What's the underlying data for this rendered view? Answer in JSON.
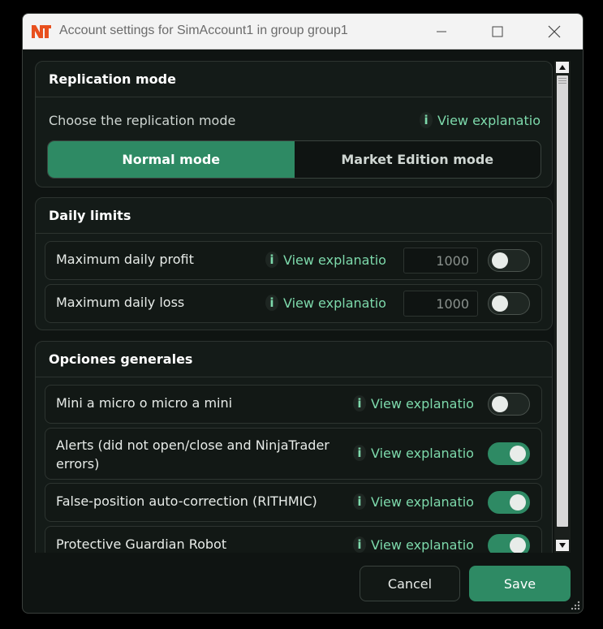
{
  "window": {
    "title": "Account settings for SimAccount1 in group group1",
    "logo_text": "NT"
  },
  "replication": {
    "header": "Replication mode",
    "label": "Choose the replication mode",
    "explain": "View explanatio",
    "modes": [
      "Normal mode",
      "Market Edition mode"
    ],
    "selected": "Normal mode"
  },
  "daily_limits": {
    "header": "Daily limits",
    "rows": [
      {
        "label": "Maximum daily profit",
        "explain": "View explanatio",
        "value": "1000",
        "enabled": false
      },
      {
        "label": "Maximum daily loss",
        "explain": "View explanatio",
        "value": "1000",
        "enabled": false
      }
    ]
  },
  "general": {
    "header": "Opciones generales",
    "rows": [
      {
        "label": "Mini a micro o micro a mini",
        "explain": "View explanatio",
        "enabled": false
      },
      {
        "label_line1": "Alerts (did not open/close and NinjaTrader",
        "label_line2": "errors)",
        "explain": "View explanatio",
        "enabled": true
      },
      {
        "label": "False-position auto-correction (RITHMIC)",
        "explain": "View explanatio",
        "enabled": true
      },
      {
        "label": "Protective Guardian Robot",
        "explain": "View explanatio",
        "enabled": true
      }
    ]
  },
  "footer": {
    "cancel_label": "Cancel",
    "save_label": "Save"
  },
  "icons": {
    "info": "i",
    "logo": "nt-logo-icon",
    "minimize": "minimize-icon",
    "maximize": "maximize-icon",
    "close": "close-icon"
  },
  "colors": {
    "accent": "#2e8a64",
    "link": "#7dd9ab",
    "background": "#0f1412",
    "card": "#141b18",
    "logo": "#e8501e"
  }
}
